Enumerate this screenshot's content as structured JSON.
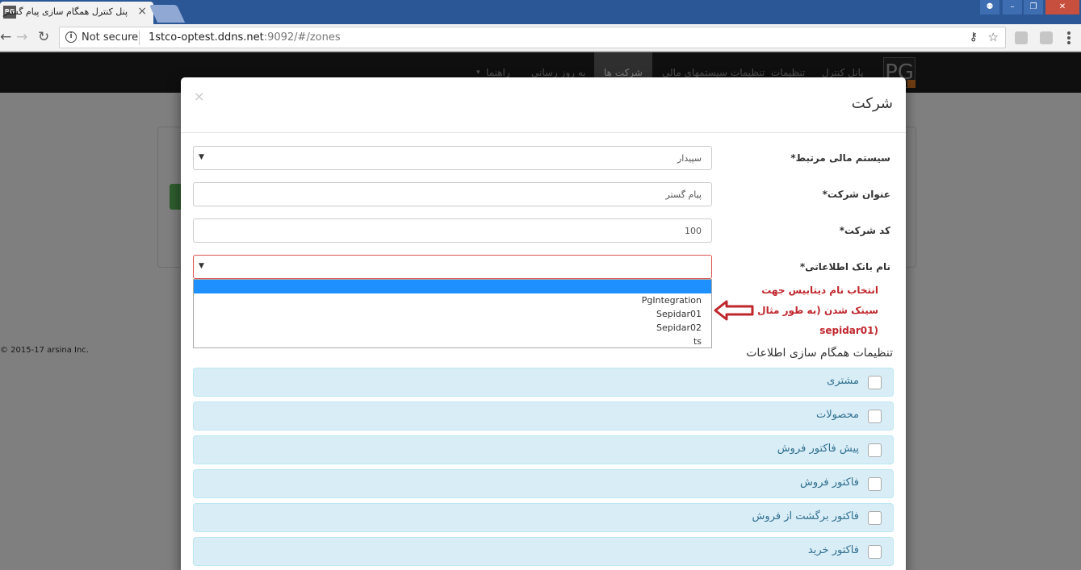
{
  "browser": {
    "tab_title": "پنل کنترل همگام سازی پیام گستر",
    "favicon_text": "PG",
    "security_label": "Not secure",
    "url_host": "1stco-optest.ddns.net",
    "url_rest": ":9092/#/zones"
  },
  "app": {
    "logo_text": "PG",
    "nav": {
      "control_panel": "پانل کنترل",
      "settings": "تنظیمات",
      "financial_settings": "تنظیمات سیستمهای مالی",
      "companies": "شرکت ها",
      "update": "به روز رسانی",
      "guide": "راهنما"
    },
    "footer": "© 2015-17 arsina Inc."
  },
  "modal": {
    "title": "شرکت",
    "close": "×",
    "fields": {
      "financial_system_label": "سیستم مالی مرتبط*",
      "financial_system_value": "سپیدار",
      "company_title_label": "عنوان شرکت*",
      "company_title_value": "پیام گستر",
      "company_code_label": "کد شرکت*",
      "company_code_value": "100",
      "database_label": "نام بانک اطلاعاتی*",
      "database_value": ""
    },
    "dropdown_options": [
      "",
      "PgIntegration",
      "Sepidar01",
      "Sepidar02",
      "ts"
    ],
    "annotation": {
      "line1": "انتخاب نام دیتابیس جهت",
      "line2": "سینک شدن (به طور مثال",
      "line3": "(sepidar01"
    },
    "sync_title": "تنظیمات همگام سازی اطلاعات",
    "sync_items": [
      "مشتری",
      "محصولات",
      "پیش فاکتور فروش",
      "فاکتور فروش",
      "فاکتور برگشت از فروش",
      "فاکتور خرید"
    ]
  }
}
